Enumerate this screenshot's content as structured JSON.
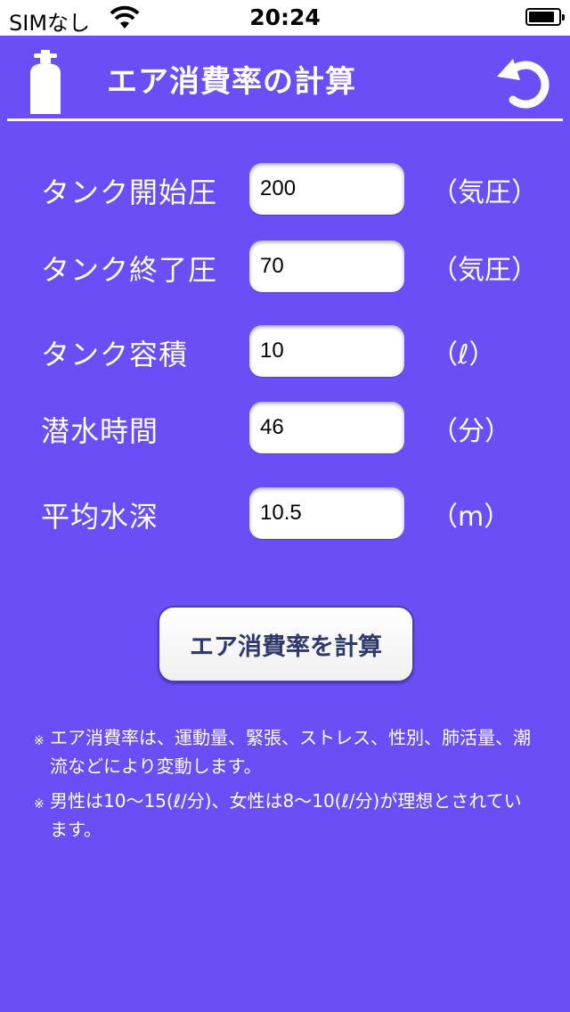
{
  "status_bar": {
    "carrier": "SIMなし",
    "time": "20:24"
  },
  "header": {
    "title": "エア消費率の計算"
  },
  "form": {
    "rows": [
      {
        "label": "タンク開始圧",
        "value": "200",
        "unit": "（気圧）"
      },
      {
        "label": "タンク終了圧",
        "value": "70",
        "unit": "（気圧）"
      },
      {
        "label": "タンク容積",
        "value": "10",
        "unit": "（ℓ）"
      },
      {
        "label": "潜水時間",
        "value": "46",
        "unit": "（分）"
      },
      {
        "label": "平均水深",
        "value": "10.5",
        "unit": "（m）"
      }
    ]
  },
  "actions": {
    "calculate_label": "エア消費率を計算"
  },
  "notes": [
    {
      "mark": "※",
      "text": "エア消費率は、運動量、緊張、ストレス、性別、肺活量、潮流などにより変動します。"
    },
    {
      "mark": "※",
      "text": "男性は10〜15(ℓ/分)、女性は8〜10(ℓ/分)が理想とされています。"
    }
  ],
  "colors": {
    "background": "#6b4ef5",
    "text": "#ffffff",
    "button_text": "#2e3a6b"
  },
  "icons": {
    "left": "air-tank-icon",
    "right": "undo-icon"
  }
}
